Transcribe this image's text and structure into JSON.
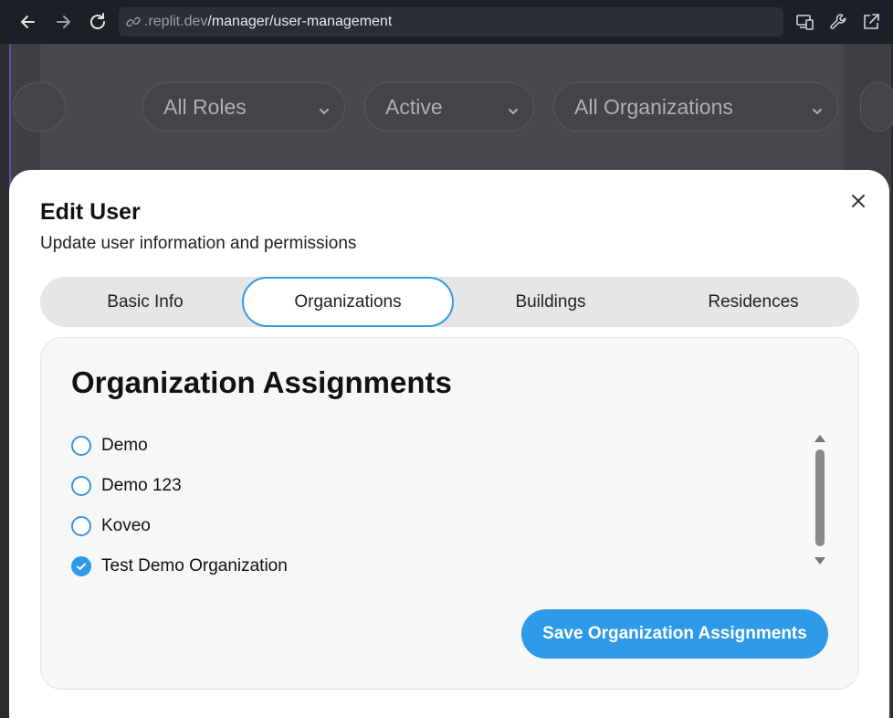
{
  "browser": {
    "url_host": ".replit.dev",
    "url_path": "/manager/user-management",
    "icons": [
      "back-arrow-icon",
      "forward-arrow-icon",
      "reload-icon",
      "link-icon",
      "devices-icon",
      "wrench-icon",
      "external-link-icon"
    ]
  },
  "filters": {
    "roles": "All Roles",
    "status": "Active",
    "organizations": "All Organizations"
  },
  "modal": {
    "title": "Edit User",
    "subtitle": "Update user information and permissions",
    "tabs": [
      {
        "label": "Basic Info"
      },
      {
        "label": "Organizations"
      },
      {
        "label": "Buildings"
      },
      {
        "label": "Residences"
      }
    ],
    "active_tab": "Organizations",
    "section_title": "Organization Assignments",
    "organizations": [
      {
        "label": "Demo",
        "checked": false
      },
      {
        "label": "Demo 123",
        "checked": false
      },
      {
        "label": "Koveo",
        "checked": false
      },
      {
        "label": "Test Demo Organization",
        "checked": true
      }
    ],
    "save_label": "Save Organization Assignments"
  },
  "colors": {
    "accent": "#2f9be8",
    "chrome_bg": "#1c1f26"
  }
}
